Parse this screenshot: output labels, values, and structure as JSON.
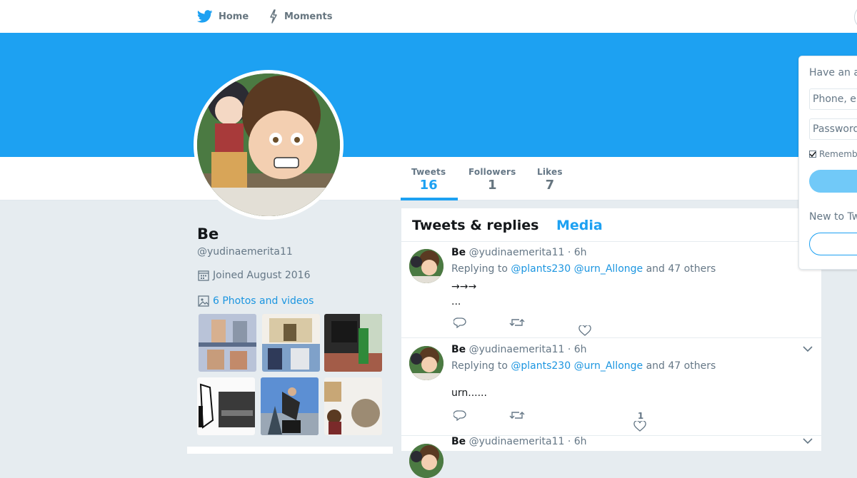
{
  "nav": {
    "home_label": "Home",
    "moments_label": "Moments"
  },
  "profile": {
    "name": "Be",
    "handle": "@yudinaemerita11",
    "joined": "Joined August 2016",
    "photos_link": "6 Photos and videos"
  },
  "stats": {
    "tweets_label": "Tweets",
    "tweets_value": "16",
    "followers_label": "Followers",
    "followers_value": "1",
    "likes_label": "Likes",
    "likes_value": "7"
  },
  "timeline": {
    "tab_replies": "Tweets & replies",
    "tab_media": "Media",
    "tweets": [
      {
        "name": "Be",
        "handle": "@yudinaemerita11",
        "time": "· 6h",
        "replying_prefix": "Replying to",
        "mention1": "@plants230",
        "mention2": "@urn_Allonge",
        "replying_suffix": "and 47 others",
        "text": "→→→\n...",
        "like_count": ""
      },
      {
        "name": "Be",
        "handle": "@yudinaemerita11",
        "time": "· 6h",
        "replying_prefix": "Replying to",
        "mention1": "@plants230",
        "mention2": "@urn_Allonge",
        "replying_suffix": "and 47 others",
        "text": "urn......",
        "like_count": "1"
      },
      {
        "name": "Be",
        "handle": "@yudinaemerita11",
        "time": "· 6h"
      }
    ]
  },
  "login": {
    "title": "Have an a",
    "phone_placeholder": "Phone, e",
    "password_placeholder": "Password",
    "remember": "Rememb",
    "new_to": "New to Tw"
  },
  "colors": {
    "brand_blue": "#1da1f2",
    "link_blue": "#1b95e0",
    "page_bg": "#e6ecf0"
  }
}
